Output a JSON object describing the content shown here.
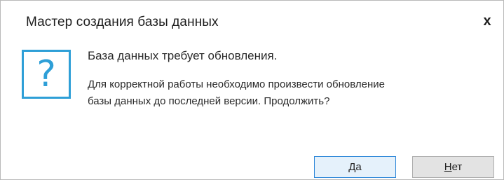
{
  "dialog": {
    "title": "Мастер создания базы данных",
    "close_glyph": "x",
    "icon": "question-icon",
    "icon_glyph": "?",
    "heading": "База данных требует обновления.",
    "message_line1": "Для корректной работы необходимо произвести обновление",
    "message_line2": "базы данных до последней версии. Продолжить?"
  },
  "buttons": {
    "yes": {
      "mnemonic": "Д",
      "rest": "а"
    },
    "no": {
      "mnemonic": "Н",
      "rest": "ет"
    }
  },
  "colors": {
    "accent": "#2e9fd7",
    "default_button_border": "#2b86d8",
    "default_button_bg": "#e5f1fb",
    "button_bg": "#e3e3e3",
    "button_border": "#adadad"
  }
}
